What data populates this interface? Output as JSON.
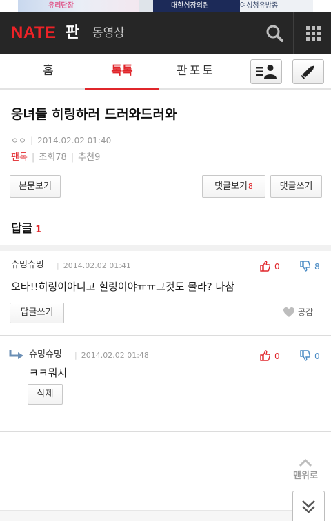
{
  "ad": {
    "text_left": "유리단장",
    "text_mid": "대한심장의원",
    "text_right": "여성청유방종"
  },
  "header": {
    "logo": "NATE",
    "section": "판",
    "sub_section": "동영상",
    "icons": [
      "search-icon",
      "menu-grid-icon"
    ]
  },
  "tabs": [
    {
      "label": "홈",
      "active": false
    },
    {
      "label": "톡톡",
      "active": true
    },
    {
      "label": "판포토",
      "active": false
    }
  ],
  "tab_buttons": [
    "profile-list-icon",
    "pencil-icon"
  ],
  "post": {
    "title": "웅녀들 히링하러 드러와드러와",
    "author": "ㅇㅇ",
    "datetime": "2014.02.02 01:40",
    "category": "팬톡",
    "views_label": "조회78",
    "recommend_label": "추천9"
  },
  "buttons": {
    "view_body": "본문보기",
    "view_comments": "댓글보기",
    "view_comments_count": "8",
    "write_comment": "댓글쓰기"
  },
  "replies": {
    "title": "답글",
    "count": "1"
  },
  "comments": [
    {
      "name": "슈밍슈밍",
      "datetime": "2014.02.02 01:41",
      "up": "0",
      "down": "8",
      "text": "오타!!히링이아니고 힐링이야ㅠㅠ그것도 몰라? 나참",
      "reply_button": "답글쓰기",
      "like_label": "공감"
    },
    {
      "name": "슈밍슈밍",
      "datetime": "2014.02.02 01:48",
      "up": "0",
      "down": "0",
      "text": "ㅋㅋ뭐지",
      "delete_button": "삭제"
    }
  ],
  "to_top": "맨위로",
  "colors": {
    "accent": "#e0262b",
    "header_bg": "#262626",
    "down_vote": "#4a8bc4"
  }
}
